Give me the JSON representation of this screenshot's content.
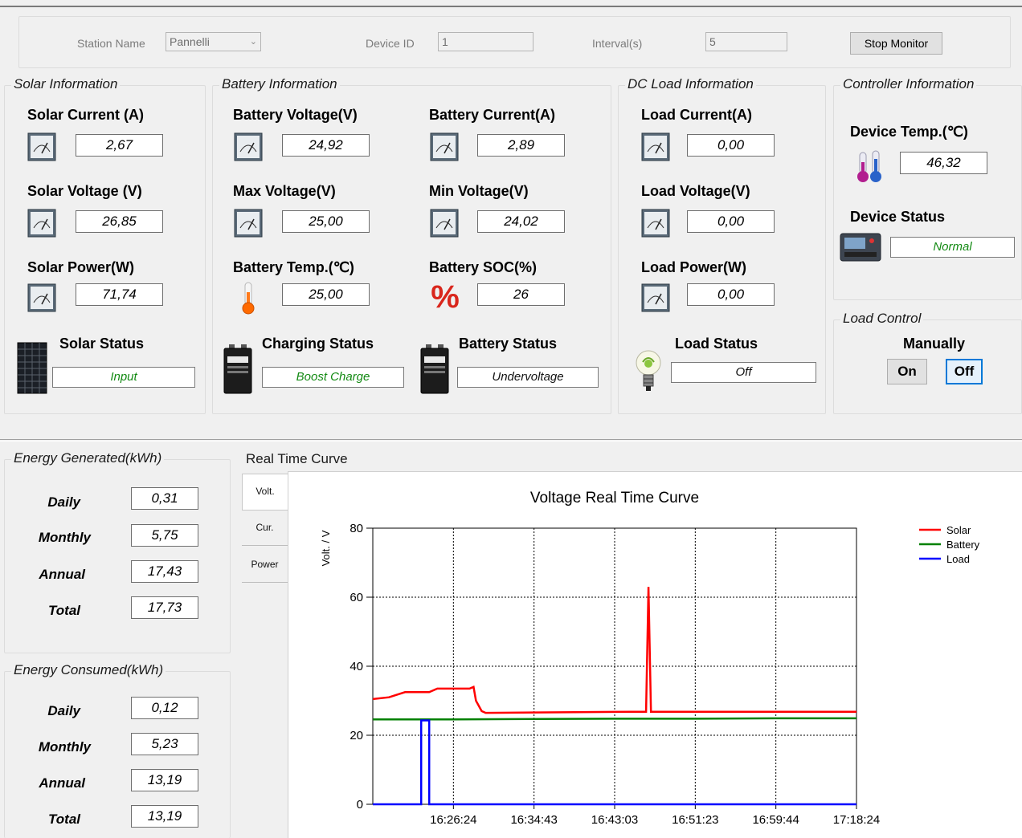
{
  "header": {
    "station_name_label": "Station Name",
    "station_name_value": "Pannelli",
    "device_id_label": "Device ID",
    "device_id_value": "1",
    "interval_label": "Interval(s)",
    "interval_value": "5",
    "stop_monitor_label": "Stop Monitor"
  },
  "solar": {
    "title": "Solar Information",
    "current_label": "Solar Current (A)",
    "current_value": "2,67",
    "voltage_label": "Solar Voltage (V)",
    "voltage_value": "26,85",
    "power_label": "Solar Power(W)",
    "power_value": "71,74",
    "status_label": "Solar Status",
    "status_value": "Input"
  },
  "battery": {
    "title": "Battery Information",
    "voltage_label": "Battery Voltage(V)",
    "voltage_value": "24,92",
    "current_label": "Battery Current(A)",
    "current_value": "2,89",
    "max_label": "Max Voltage(V)",
    "max_value": "25,00",
    "min_label": "Min Voltage(V)",
    "min_value": "24,02",
    "temp_label": "Battery Temp.(℃)",
    "temp_value": "25,00",
    "soc_label": "Battery SOC(%)",
    "soc_value": "26",
    "charging_label": "Charging Status",
    "charging_value": "Boost Charge",
    "status_label": "Battery Status",
    "status_value": "Undervoltage"
  },
  "dcload": {
    "title": "DC Load Information",
    "current_label": "Load Current(A)",
    "current_value": "0,00",
    "voltage_label": "Load Voltage(V)",
    "voltage_value": "0,00",
    "power_label": "Load Power(W)",
    "power_value": "0,00",
    "status_label": "Load Status",
    "status_value": "Off"
  },
  "controller": {
    "title": "Controller Information",
    "temp_label": "Device Temp.(℃)",
    "temp_value": "46,32",
    "status_label": "Device Status",
    "status_value": "Normal"
  },
  "load_control": {
    "title": "Load Control",
    "mode_label": "Manually",
    "on_label": "On",
    "off_label": "Off"
  },
  "energy_generated": {
    "title": "Energy Generated(kWh)",
    "daily_label": "Daily",
    "daily_value": "0,31",
    "monthly_label": "Monthly",
    "monthly_value": "5,75",
    "annual_label": "Annual",
    "annual_value": "17,43",
    "total_label": "Total",
    "total_value": "17,73"
  },
  "energy_consumed": {
    "title": "Energy Consumed(kWh)",
    "daily_label": "Daily",
    "daily_value": "0,12",
    "monthly_label": "Monthly",
    "monthly_value": "5,23",
    "annual_label": "Annual",
    "annual_value": "13,19",
    "total_label": "Total",
    "total_value": "13,19"
  },
  "curve": {
    "section_title": "Real Time Curve",
    "tabs": [
      "Volt.",
      "Cur.",
      "Power"
    ]
  },
  "icons": {
    "meter": "meter-gauge-icon",
    "thermometer": "thermometer-icon",
    "percent": "percent-icon",
    "solar_panel": "solar-panel-icon",
    "battery": "battery-icon",
    "bulb": "light-bulb-icon",
    "controller": "charge-controller-icon"
  },
  "colors": {
    "solar": "#ff0000",
    "battery": "#008000",
    "load": "#0000ff",
    "status_text": "#138a13",
    "active_button_border": "#0078d7"
  },
  "chart_data": {
    "type": "line",
    "title": "Voltage Real Time Curve",
    "ylabel": "Volt. / V",
    "xlabel": "",
    "ylim": [
      0,
      80
    ],
    "yticks": [
      0,
      20,
      40,
      60,
      80
    ],
    "xticks": [
      "16:26:24",
      "16:34:43",
      "16:43:03",
      "16:51:23",
      "16:59:44",
      "17:18:24"
    ],
    "xlim": [
      0,
      6
    ],
    "grid": true,
    "legend_position": "top-right",
    "series": [
      {
        "name": "Solar",
        "color": "#ff0000",
        "points": [
          [
            0,
            30.5
          ],
          [
            0.2,
            31
          ],
          [
            0.4,
            32.5
          ],
          [
            0.7,
            32.5
          ],
          [
            0.8,
            33.5
          ],
          [
            1.0,
            33.5
          ],
          [
            1.2,
            33.5
          ],
          [
            1.25,
            34
          ],
          [
            1.28,
            30
          ],
          [
            1.35,
            27
          ],
          [
            1.4,
            26.5
          ],
          [
            2.0,
            26.6
          ],
          [
            2.5,
            26.7
          ],
          [
            3.2,
            26.8
          ],
          [
            3.39,
            26.8
          ],
          [
            3.42,
            63
          ],
          [
            3.45,
            26.8
          ],
          [
            4.0,
            26.8
          ],
          [
            5.0,
            26.8
          ],
          [
            6.0,
            26.8
          ]
        ]
      },
      {
        "name": "Battery",
        "color": "#008000",
        "points": [
          [
            0,
            24.6
          ],
          [
            1.0,
            24.6
          ],
          [
            2.0,
            24.7
          ],
          [
            3.0,
            24.8
          ],
          [
            4.0,
            24.8
          ],
          [
            5.0,
            24.9
          ],
          [
            6.0,
            24.9
          ]
        ]
      },
      {
        "name": "Load",
        "color": "#0000ff",
        "points": [
          [
            0,
            0
          ],
          [
            0.6,
            0
          ],
          [
            0.6,
            24.3
          ],
          [
            0.7,
            24.3
          ],
          [
            0.7,
            0
          ],
          [
            6.0,
            0
          ]
        ]
      }
    ]
  }
}
